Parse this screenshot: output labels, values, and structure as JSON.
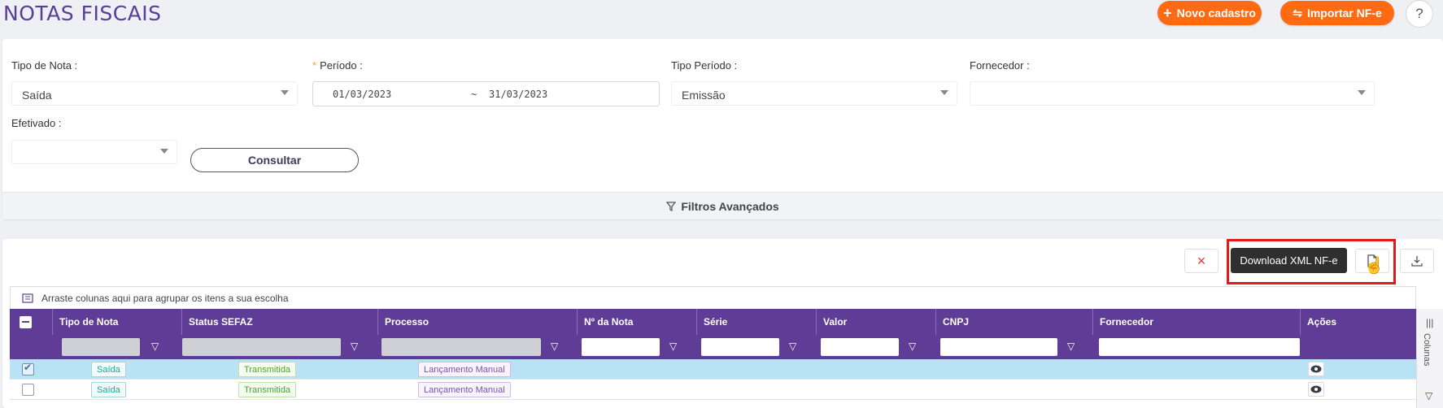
{
  "header": {
    "title": "NOTAS FISCAIS",
    "novo_cadastro_label": "Novo cadastro",
    "importar_label": "Importar NF-e",
    "help_label": "?"
  },
  "filters": {
    "tipo_nota": {
      "label": "Tipo de Nota :",
      "value": "Saída"
    },
    "periodo": {
      "label": "Período :",
      "required_mark": "*",
      "start": "01/03/2023",
      "separator": "~",
      "end": "31/03/2023"
    },
    "tipo_periodo": {
      "label": "Tipo Período :",
      "value": "Emissão"
    },
    "fornecedor": {
      "label": "Fornecedor :",
      "value": ""
    },
    "efetivado": {
      "label": "Efetivado :",
      "value": ""
    },
    "consultar_label": "Consultar",
    "advanced_label": "Filtros Avançados"
  },
  "toolbar": {
    "tooltip": "Download XML NF-e",
    "close_label": "×"
  },
  "grid": {
    "group_hint": "Arraste colunas aqui para agrupar os itens a sua escolha",
    "columns": [
      "Tipo de Nota",
      "Status SEFAZ",
      "Processo",
      "Nº da Nota",
      "Série",
      "Valor",
      "CNPJ",
      "Fornecedor",
      "Ações"
    ],
    "rows": [
      {
        "selected": true,
        "tipo": "Saída",
        "status": "Transmitida",
        "processo": "Lançamento Manual"
      },
      {
        "selected": false,
        "tipo": "Saída",
        "status": "Transmitida",
        "processo": "Lançamento Manual"
      }
    ],
    "columns_tab_label": "Colunas"
  },
  "colors": {
    "brand_purple": "#5f3d97",
    "orange": "#ff6a13",
    "highlight": "#e31a1a"
  }
}
